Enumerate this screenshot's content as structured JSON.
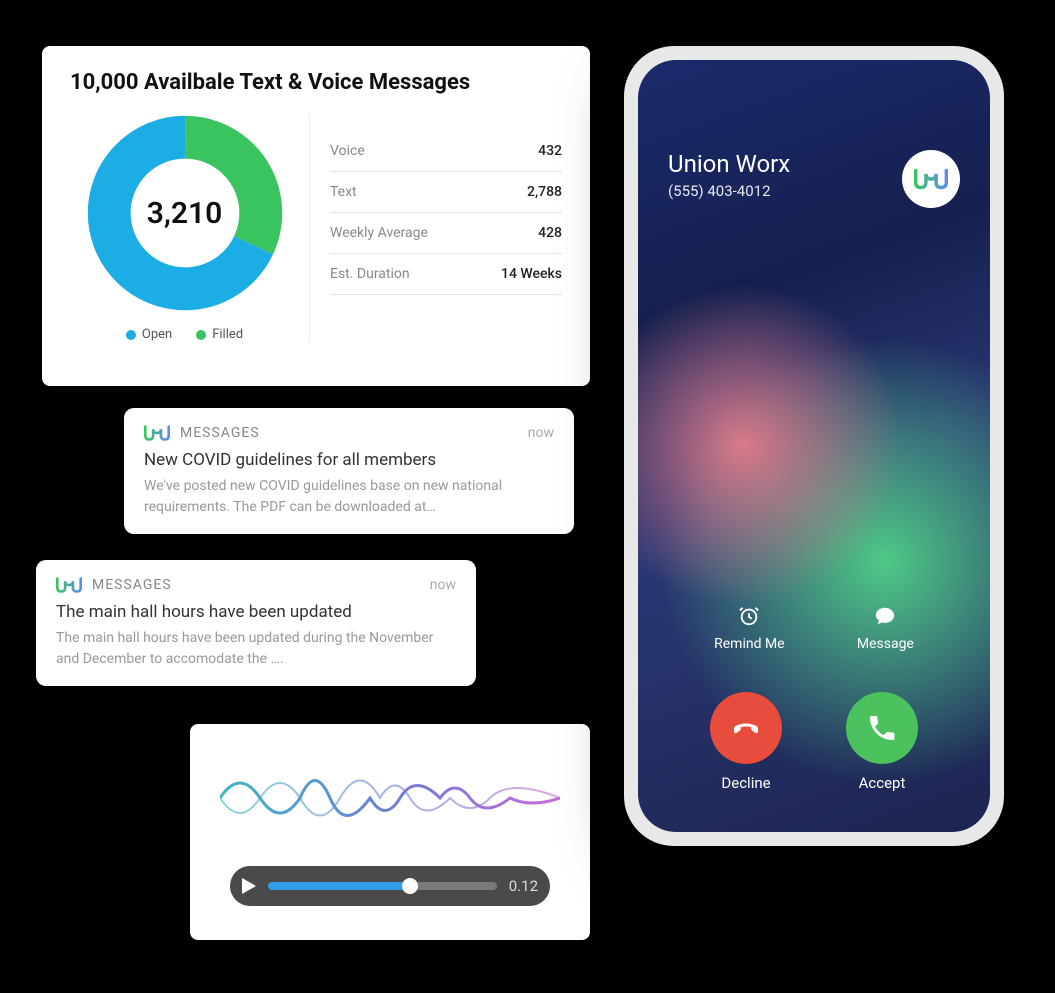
{
  "stats": {
    "title": "10,000 Availbale Text & Voice Messages",
    "center_value": "3,210",
    "legend": {
      "open": "Open",
      "filled": "Filled"
    },
    "rows": [
      {
        "label": "Voice",
        "value": "432"
      },
      {
        "label": "Text",
        "value": "2,788"
      },
      {
        "label": "Weekly Average",
        "value": "428"
      },
      {
        "label": "Est. Duration",
        "value": "14 Weeks"
      }
    ]
  },
  "chart_data": {
    "type": "pie",
    "title": "10,000 Availbale Text & Voice Messages",
    "center_label": "3,210",
    "series": [
      {
        "name": "Open",
        "value": 68,
        "color": "#1cade4"
      },
      {
        "name": "Filled",
        "value": 32,
        "color": "#3ac45f"
      }
    ]
  },
  "notifications": [
    {
      "app": "MESSAGES",
      "time": "now",
      "title": "New COVID guidelines for all members",
      "body": "We've posted new COVID guidelines base on new national requirements. The PDF can be downloaded at…"
    },
    {
      "app": "MESSAGES",
      "time": "now",
      "title": "The main hall hours have been updated",
      "body": "The main hall hours have been updated during the November and December to accomodate the …."
    }
  ],
  "audio": {
    "time": "0.12",
    "progress_percent": 62
  },
  "phone": {
    "caller_name": "Union Worx",
    "caller_phone": "(555) 403-4012",
    "remind": "Remind Me",
    "message": "Message",
    "decline": "Decline",
    "accept": "Accept"
  }
}
